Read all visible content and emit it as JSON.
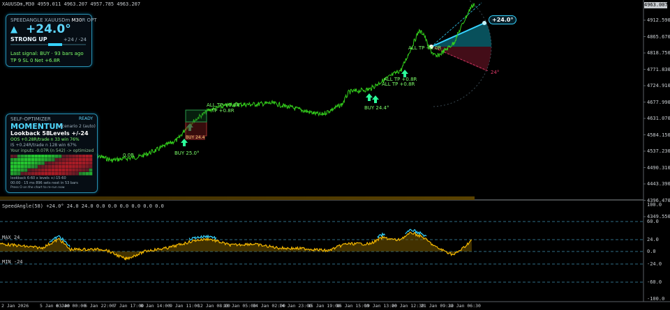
{
  "header": {
    "symbol_tf": "XAUUSDm,M30",
    "ohlc": "4959.011 4963.207 4957.785 4963.207",
    "last_price": "4963.007"
  },
  "colors": {
    "price_line": "#34d11c",
    "indicator_line": "#f5b800",
    "accent_cyan": "#36d3ff",
    "grid": "#16262e",
    "wedge_pos": "#0b6b7a",
    "wedge_neg": "#5a1220"
  },
  "price_axis": [
    "4912.590",
    "4865.670",
    "4818.750",
    "4771.830",
    "4724.910",
    "4677.990",
    "4631.070",
    "4584.150",
    "4537.230",
    "4490.310",
    "4443.390",
    "4396.470",
    "4349.550"
  ],
  "indicator": {
    "title": "SpeedAngle(58)  +24.0° 24.0 24.0 0.0 0.0 0.0 0.0 0.0 0.0",
    "axis": [
      "100.0",
      "60.0",
      "24.0",
      "0.0",
      "-24.0",
      "-60.0",
      "-100.0"
    ],
    "max_label": "MAX 24",
    "min_label": "MIN -24"
  },
  "time_axis": [
    "2 Jan 2026",
    "5 Jan 03:00",
    "6 Jan 00:00",
    "6 Jan 22:00",
    "7 Jan 17:00",
    "8 Jan 14:00",
    "9 Jan 11:00",
    "12 Jan 08:00",
    "13 Jan 05:00",
    "14 Jan 02:00",
    "14 Jan 23:00",
    "15 Jan 19:00",
    "16 Jan 15:00",
    "19 Jan 13:00",
    "20 Jan 12:30",
    "21 Jan 09:30",
    "22 Jan 06:30"
  ],
  "annotations": {
    "buy1": "BUY 25.0°",
    "buy1_tag": "BUY 24.4",
    "all_tp1": "ALL TP  +0.8R",
    "tp1": "TP  +0.8R",
    "buy2": "BUY 24.4°",
    "all_tp2": "ALL TP  +0.8R",
    "all_tp2b": "ALL TP  +0.8R",
    "all_tp3": "ALL TP  +0.0R",
    "angle_bubble": "+24.0°",
    "neg_angle": "24°",
    "left_fragment": "0.0R"
  },
  "speed_panel": {
    "title": "SPEEDANGLE",
    "symbol": "XAUUSDm",
    "tf": "M30",
    "mode": "R OPT",
    "angle": "+24.0°",
    "arrow": "▲",
    "status": "STRONG UP",
    "range": "+24 / -24",
    "last_signal": "Last signal: BUY  ·  93 bars ago",
    "stats": "TP 9    SL 0    Net +6.8R"
  },
  "optimizer": {
    "title": "SELF-OPTIMIZER",
    "state": "READY",
    "mode": "MOMENTUM",
    "scenario": "Scenario 2 (auto)",
    "lookback": "Lookback 58",
    "levels": "Levels +/-24",
    "oos": "OOS   +0.28R/trade   n 33   win 76%",
    "is": "IS    +0.24R/trade   n 128   win 67%",
    "inputs": "Your inputs  -0.07R (n 542)   ->   optimized",
    "range_line": "lookback 6-60   x   levels +/-15-60",
    "timing": "00:00 · 15 ms    896 sets    next in 53 bars",
    "hint": "Press O on the chart to re-run now"
  }
}
